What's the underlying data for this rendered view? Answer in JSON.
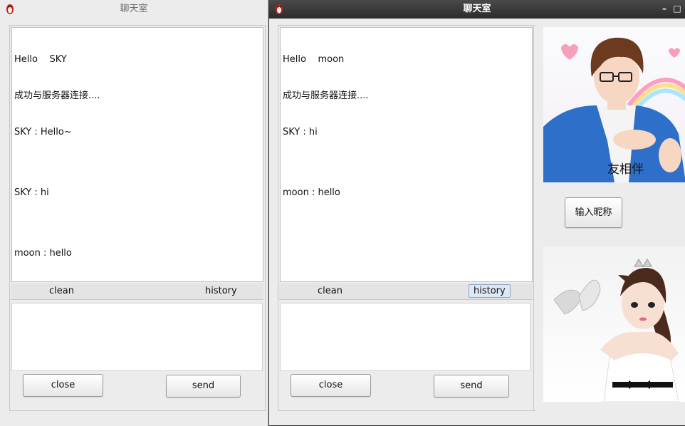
{
  "left_window": {
    "title": "聊天室",
    "log_lines": [
      "Hello    SKY",
      "成功与服务器连接....",
      "SKY : Hello~",
      "",
      "SKY : hi",
      "",
      "moon : hello"
    ],
    "clean_label": "clean",
    "history_label": "history",
    "input_value": "",
    "close_label": "close",
    "send_label": "send"
  },
  "right_window": {
    "title": "聊天室",
    "minimize_symbol": "–",
    "maximize_symbol": "□",
    "log_lines": [
      "Hello    moon",
      "成功与服务器连接....",
      "SKY : hi",
      "",
      "moon : hello"
    ],
    "clean_label": "clean",
    "history_label": "history",
    "input_value": "",
    "close_label": "close",
    "send_label": "send",
    "nickname_button": "输入昵称",
    "boy_shirt_text": "友相伴"
  },
  "icons": {
    "app": "penguin-icon"
  },
  "colors": {
    "titlebar_active": "#2b2b2b",
    "history_highlight": "#dde8f5",
    "boy_jacket": "#2e6fc9"
  }
}
